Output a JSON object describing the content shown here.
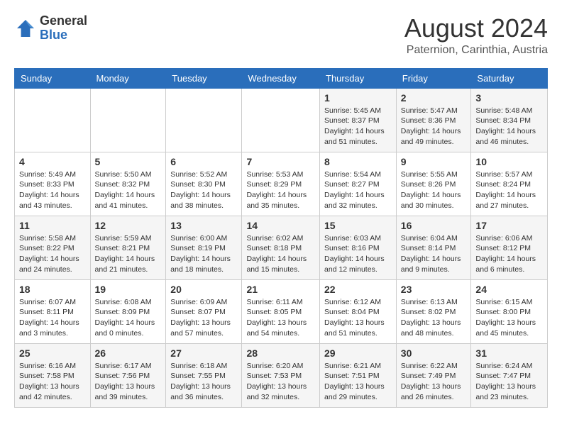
{
  "header": {
    "logo_general": "General",
    "logo_blue": "Blue",
    "month_year": "August 2024",
    "location": "Paternion, Carinthia, Austria"
  },
  "days_of_week": [
    "Sunday",
    "Monday",
    "Tuesday",
    "Wednesday",
    "Thursday",
    "Friday",
    "Saturday"
  ],
  "weeks": [
    [
      {
        "day": "",
        "info": ""
      },
      {
        "day": "",
        "info": ""
      },
      {
        "day": "",
        "info": ""
      },
      {
        "day": "",
        "info": ""
      },
      {
        "day": "1",
        "info": "Sunrise: 5:45 AM\nSunset: 8:37 PM\nDaylight: 14 hours\nand 51 minutes."
      },
      {
        "day": "2",
        "info": "Sunrise: 5:47 AM\nSunset: 8:36 PM\nDaylight: 14 hours\nand 49 minutes."
      },
      {
        "day": "3",
        "info": "Sunrise: 5:48 AM\nSunset: 8:34 PM\nDaylight: 14 hours\nand 46 minutes."
      }
    ],
    [
      {
        "day": "4",
        "info": "Sunrise: 5:49 AM\nSunset: 8:33 PM\nDaylight: 14 hours\nand 43 minutes."
      },
      {
        "day": "5",
        "info": "Sunrise: 5:50 AM\nSunset: 8:32 PM\nDaylight: 14 hours\nand 41 minutes."
      },
      {
        "day": "6",
        "info": "Sunrise: 5:52 AM\nSunset: 8:30 PM\nDaylight: 14 hours\nand 38 minutes."
      },
      {
        "day": "7",
        "info": "Sunrise: 5:53 AM\nSunset: 8:29 PM\nDaylight: 14 hours\nand 35 minutes."
      },
      {
        "day": "8",
        "info": "Sunrise: 5:54 AM\nSunset: 8:27 PM\nDaylight: 14 hours\nand 32 minutes."
      },
      {
        "day": "9",
        "info": "Sunrise: 5:55 AM\nSunset: 8:26 PM\nDaylight: 14 hours\nand 30 minutes."
      },
      {
        "day": "10",
        "info": "Sunrise: 5:57 AM\nSunset: 8:24 PM\nDaylight: 14 hours\nand 27 minutes."
      }
    ],
    [
      {
        "day": "11",
        "info": "Sunrise: 5:58 AM\nSunset: 8:22 PM\nDaylight: 14 hours\nand 24 minutes."
      },
      {
        "day": "12",
        "info": "Sunrise: 5:59 AM\nSunset: 8:21 PM\nDaylight: 14 hours\nand 21 minutes."
      },
      {
        "day": "13",
        "info": "Sunrise: 6:00 AM\nSunset: 8:19 PM\nDaylight: 14 hours\nand 18 minutes."
      },
      {
        "day": "14",
        "info": "Sunrise: 6:02 AM\nSunset: 8:18 PM\nDaylight: 14 hours\nand 15 minutes."
      },
      {
        "day": "15",
        "info": "Sunrise: 6:03 AM\nSunset: 8:16 PM\nDaylight: 14 hours\nand 12 minutes."
      },
      {
        "day": "16",
        "info": "Sunrise: 6:04 AM\nSunset: 8:14 PM\nDaylight: 14 hours\nand 9 minutes."
      },
      {
        "day": "17",
        "info": "Sunrise: 6:06 AM\nSunset: 8:12 PM\nDaylight: 14 hours\nand 6 minutes."
      }
    ],
    [
      {
        "day": "18",
        "info": "Sunrise: 6:07 AM\nSunset: 8:11 PM\nDaylight: 14 hours\nand 3 minutes."
      },
      {
        "day": "19",
        "info": "Sunrise: 6:08 AM\nSunset: 8:09 PM\nDaylight: 14 hours\nand 0 minutes."
      },
      {
        "day": "20",
        "info": "Sunrise: 6:09 AM\nSunset: 8:07 PM\nDaylight: 13 hours\nand 57 minutes."
      },
      {
        "day": "21",
        "info": "Sunrise: 6:11 AM\nSunset: 8:05 PM\nDaylight: 13 hours\nand 54 minutes."
      },
      {
        "day": "22",
        "info": "Sunrise: 6:12 AM\nSunset: 8:04 PM\nDaylight: 13 hours\nand 51 minutes."
      },
      {
        "day": "23",
        "info": "Sunrise: 6:13 AM\nSunset: 8:02 PM\nDaylight: 13 hours\nand 48 minutes."
      },
      {
        "day": "24",
        "info": "Sunrise: 6:15 AM\nSunset: 8:00 PM\nDaylight: 13 hours\nand 45 minutes."
      }
    ],
    [
      {
        "day": "25",
        "info": "Sunrise: 6:16 AM\nSunset: 7:58 PM\nDaylight: 13 hours\nand 42 minutes."
      },
      {
        "day": "26",
        "info": "Sunrise: 6:17 AM\nSunset: 7:56 PM\nDaylight: 13 hours\nand 39 minutes."
      },
      {
        "day": "27",
        "info": "Sunrise: 6:18 AM\nSunset: 7:55 PM\nDaylight: 13 hours\nand 36 minutes."
      },
      {
        "day": "28",
        "info": "Sunrise: 6:20 AM\nSunset: 7:53 PM\nDaylight: 13 hours\nand 32 minutes."
      },
      {
        "day": "29",
        "info": "Sunrise: 6:21 AM\nSunset: 7:51 PM\nDaylight: 13 hours\nand 29 minutes."
      },
      {
        "day": "30",
        "info": "Sunrise: 6:22 AM\nSunset: 7:49 PM\nDaylight: 13 hours\nand 26 minutes."
      },
      {
        "day": "31",
        "info": "Sunrise: 6:24 AM\nSunset: 7:47 PM\nDaylight: 13 hours\nand 23 minutes."
      }
    ]
  ]
}
